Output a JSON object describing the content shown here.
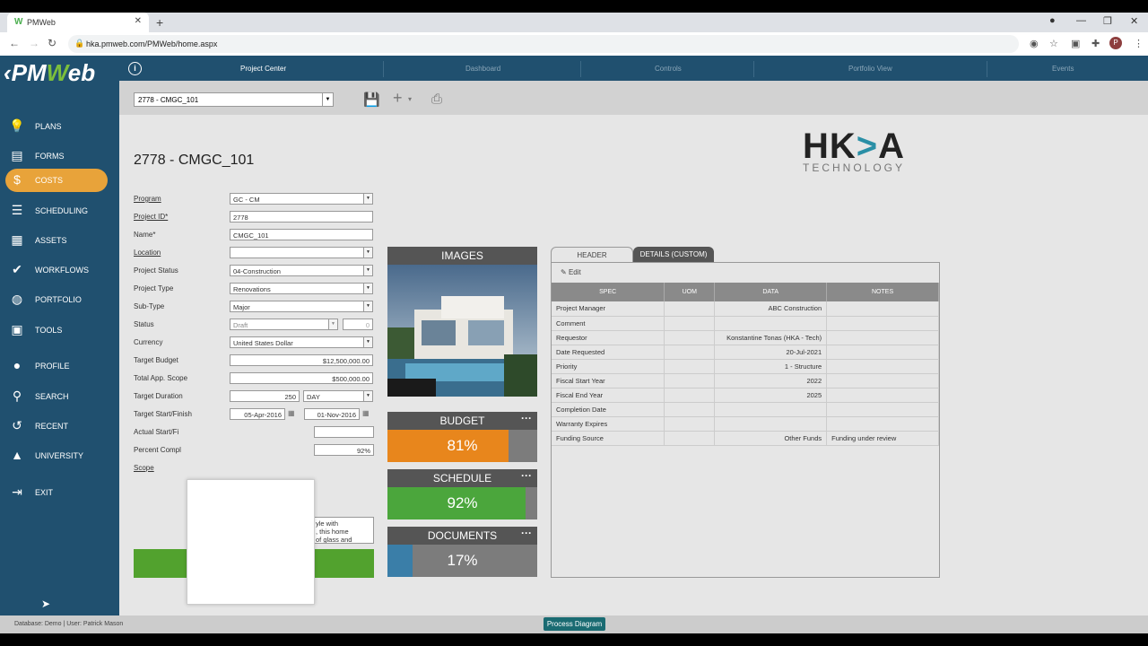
{
  "browser": {
    "tab_title": "PMWeb",
    "url": "hka.pmweb.com/PMWeb/home.aspx"
  },
  "logo": {
    "pre": "‹PM",
    "w": "W",
    "post": "eb"
  },
  "sidebar": {
    "items": [
      {
        "label": "PLANS",
        "icon": "lightbulb-icon"
      },
      {
        "label": "FORMS",
        "icon": "document-icon"
      },
      {
        "label": "COSTS",
        "icon": "dollar-icon"
      },
      {
        "label": "SCHEDULING",
        "icon": "scheduling-icon"
      },
      {
        "label": "ASSETS",
        "icon": "building-icon"
      },
      {
        "label": "WORKFLOWS",
        "icon": "check-icon"
      },
      {
        "label": "PORTFOLIO",
        "icon": "globe-icon"
      },
      {
        "label": "TOOLS",
        "icon": "toolbox-icon"
      },
      {
        "label": "PROFILE",
        "icon": "user-icon"
      },
      {
        "label": "SEARCH",
        "icon": "search-icon"
      },
      {
        "label": "RECENT",
        "icon": "history-icon"
      },
      {
        "label": "UNIVERSITY",
        "icon": "graduation-icon"
      },
      {
        "label": "EXIT",
        "icon": "exit-icon"
      }
    ]
  },
  "topnav": {
    "tabs": [
      "Project Center",
      "Dashboard",
      "Controls",
      "Portfolio View",
      "Events"
    ]
  },
  "toolbar": {
    "project_select": "2778 - CMGC_101"
  },
  "page": {
    "title": "2778 - CMGC_101"
  },
  "brand": {
    "big_a": "HK",
    "big_arrow": ">",
    "big_b": "A",
    "small": "TECHNOLOGY"
  },
  "form": {
    "program_label": "Program",
    "program": "GC - CM",
    "projectid_label": "Project ID*",
    "projectid": "2778",
    "name_label": "Name*",
    "name": "CMGC_101",
    "location_label": "Location",
    "location": "",
    "status_label": "Project Status",
    "status": "04-Construction",
    "type_label": "Project Type",
    "type": "Renovations",
    "subtype_label": "Sub-Type",
    "subtype": "Major",
    "st_label": "Status",
    "st": "Draft",
    "st_num": "0",
    "currency_label": "Currency",
    "currency": "United States Dollar",
    "budget_label": "Target Budget",
    "budget": "$12,500,000.00",
    "scope_amt_label": "Total App. Scope",
    "scope_amt": "$500,000.00",
    "duration_label": "Target Duration",
    "duration": "250",
    "duration_unit": "DAY",
    "startfinish_label": "Target Start/Finish",
    "start": "05-Apr-2016",
    "finish": "01-Nov-2016",
    "actual_label": "Actual Start/Fi",
    "percent_label": "Percent Compl",
    "percent": "92%",
    "scope_label": "Scope",
    "scope_text": "yle with\n, this home\nof glass and"
  },
  "cards": {
    "images": "IMAGES",
    "budget": {
      "title": "BUDGET",
      "pct": "81%",
      "value": 81,
      "color": "#e8861c"
    },
    "schedule": {
      "title": "SCHEDULE",
      "pct": "92%",
      "value": 92,
      "color": "#4ba63c"
    },
    "documents": {
      "title": "DOCUMENTS",
      "pct": "17%",
      "value": 17,
      "color": "#3a7ea8"
    }
  },
  "spec": {
    "tab_header": "HEADER",
    "tab_details": "DETAILS (CUSTOM)",
    "edit": "Edit",
    "columns": [
      "SPEC",
      "UOM",
      "DATA",
      "NOTES"
    ],
    "rows": [
      {
        "spec": "Project Manager",
        "uom": "",
        "data": "ABC Construction",
        "notes": ""
      },
      {
        "spec": "Comment",
        "uom": "",
        "data": "",
        "notes": ""
      },
      {
        "spec": "Requestor",
        "uom": "",
        "data": "Konstantine Tonas (HKA - Tech)",
        "notes": ""
      },
      {
        "spec": "Date Requested",
        "uom": "",
        "data": "20-Jul-2021",
        "notes": ""
      },
      {
        "spec": "Priority",
        "uom": "",
        "data": "1 - Structure",
        "notes": ""
      },
      {
        "spec": "Fiscal Start Year",
        "uom": "",
        "data": "2022",
        "notes": ""
      },
      {
        "spec": "Fiscal End Year",
        "uom": "",
        "data": "2025",
        "notes": ""
      },
      {
        "spec": "Completion Date",
        "uom": "",
        "data": "",
        "notes": ""
      },
      {
        "spec": "Warranty Expires",
        "uom": "",
        "data": "",
        "notes": ""
      },
      {
        "spec": "Funding Source",
        "uom": "",
        "data": "Other Funds",
        "notes": "Funding under review"
      }
    ]
  },
  "status": {
    "text": "Database: Demo | User: Patrick Mason",
    "process_btn": "Process Diagram"
  }
}
